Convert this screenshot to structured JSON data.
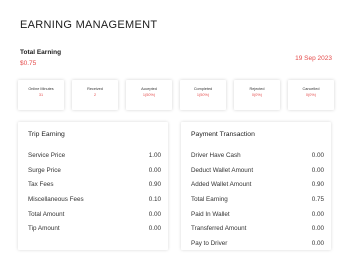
{
  "page_title": "EARNING MANAGEMENT",
  "summary": {
    "label": "Total Earning",
    "value": "$0.75",
    "date": "19 Sep 2023"
  },
  "stats": [
    {
      "label": "Online Minutes",
      "value": "31"
    },
    {
      "label": "Received",
      "value": "2"
    },
    {
      "label": "Accepted",
      "value": "1(50%)"
    },
    {
      "label": "Completed",
      "value": "1(50%)"
    },
    {
      "label": "Rejected",
      "value": "0(0%)"
    },
    {
      "label": "Cancelled",
      "value": "0(0%)"
    }
  ],
  "trip_earning": {
    "title": "Trip Earning",
    "rows": [
      {
        "label": "Service Price",
        "value": "1.00"
      },
      {
        "label": "Surge Price",
        "value": "0.00"
      },
      {
        "label": "Tax Fees",
        "value": "0.90"
      },
      {
        "label": "Miscellaneous Fees",
        "value": "0.10"
      },
      {
        "label": "Total Amount",
        "value": "0.00"
      },
      {
        "label": "Tip Amount",
        "value": "0.00"
      }
    ]
  },
  "payment_transaction": {
    "title": "Payment Transaction",
    "rows": [
      {
        "label": "Driver Have Cash",
        "value": "0.00"
      },
      {
        "label": "Deduct Wallet Amount",
        "value": "0.00"
      },
      {
        "label": "Added Wallet Amount",
        "value": "0.90"
      },
      {
        "label": "Total Earning",
        "value": "0.75"
      },
      {
        "label": "Paid In Wallet",
        "value": "0.00"
      },
      {
        "label": "Transferred Amount",
        "value": "0.00"
      },
      {
        "label": "Pay to Driver",
        "value": "0.00"
      }
    ]
  }
}
